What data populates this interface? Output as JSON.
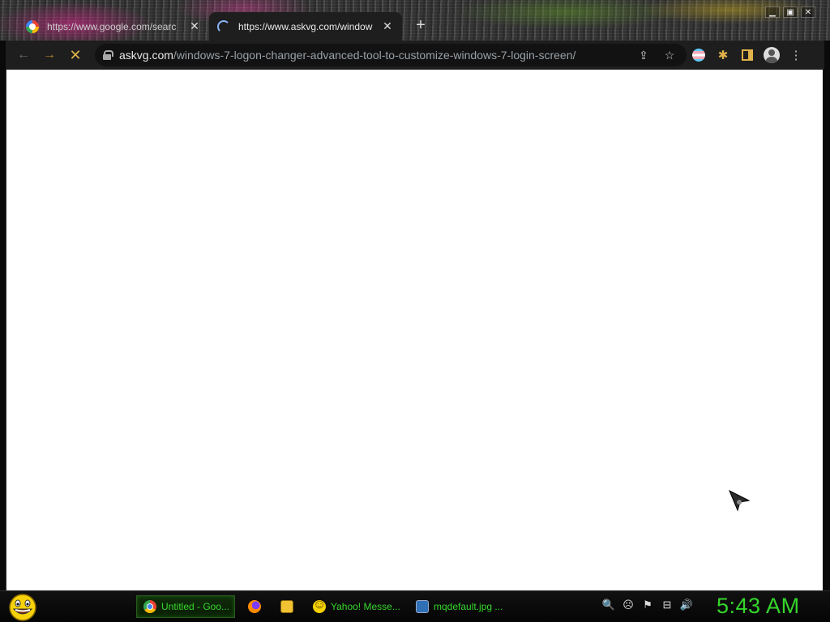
{
  "browser": {
    "tabs": [
      {
        "title": "https://www.google.com/searc",
        "icon": "google-icon",
        "active": false
      },
      {
        "title": "https://www.askvg.com/window",
        "icon": "loading-spinner-icon",
        "active": true
      }
    ],
    "tab_close_glyph": "✕",
    "new_tab_glyph": "+",
    "window_controls": {
      "minimize": "▁",
      "maximize": "▣",
      "close": "✕"
    },
    "toolbar": {
      "back_glyph": "←",
      "forward_glyph": "→",
      "stop_glyph": "✕",
      "url_domain": "askvg.com",
      "url_path": "/windows-7-logon-changer-advanced-tool-to-customize-windows-7-login-screen/",
      "share_glyph": "⇪",
      "bookmark_glyph": "☆",
      "extensions_glyph": "✱",
      "menu_glyph": "⋮"
    }
  },
  "taskbar": {
    "tasks": [
      {
        "label": "Untitled - Goo...",
        "icon": "chrome-icon",
        "active": true
      },
      {
        "label": "",
        "icon": "firefox-icon",
        "active": false
      },
      {
        "label": "",
        "icon": "folder-icon",
        "active": false
      },
      {
        "label": "Yahoo! Messe...",
        "icon": "yahoo-messenger-icon",
        "active": false
      },
      {
        "label": "mqdefault.jpg ...",
        "icon": "image-viewer-icon",
        "active": false
      }
    ],
    "tray": {
      "search_glyph": "🔍",
      "messenger_glyph": "☹",
      "flag_glyph": "⚑",
      "network_glyph": "⊟",
      "volume_glyph": "🔊"
    },
    "clock": "5:43 AM"
  }
}
